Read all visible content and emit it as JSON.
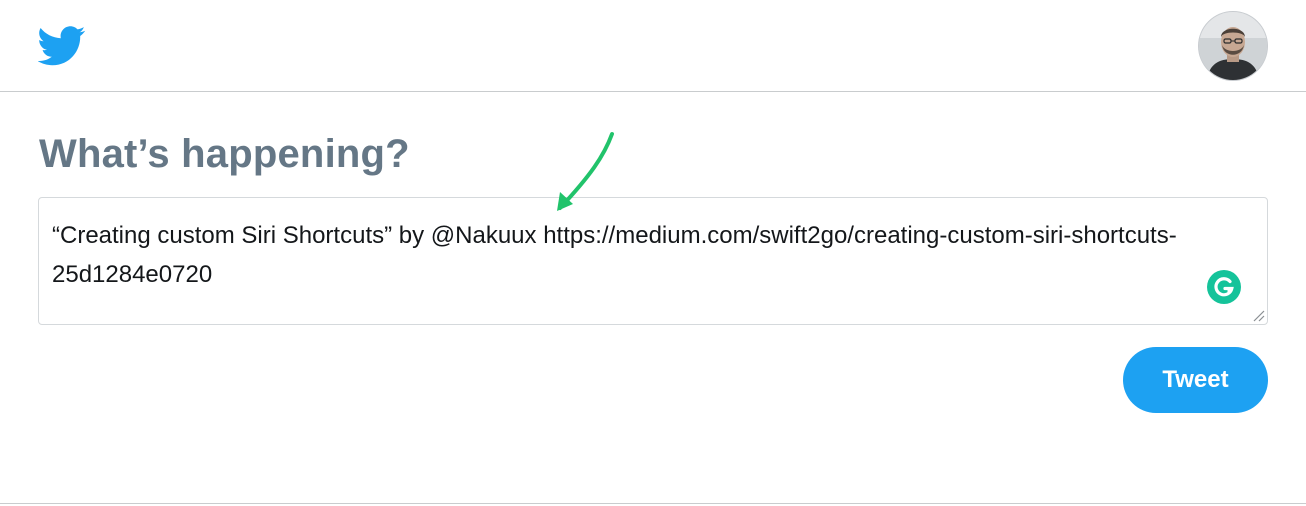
{
  "header": {
    "logo_icon": "twitter-bird-icon",
    "avatar_icon": "user-avatar"
  },
  "compose": {
    "heading": "What’s happening?",
    "text": "“Creating custom Siri Shortcuts” by @Nakuux https://medium.com/swift2go/creating-custom-siri-shortcuts-25d1284e0720",
    "grammarly_icon": "grammarly-icon",
    "tweet_label": "Tweet"
  },
  "colors": {
    "brand": "#1da1f2",
    "heading": "#657786",
    "grammarly": "#15c39a",
    "annotation": "#21c36b"
  }
}
